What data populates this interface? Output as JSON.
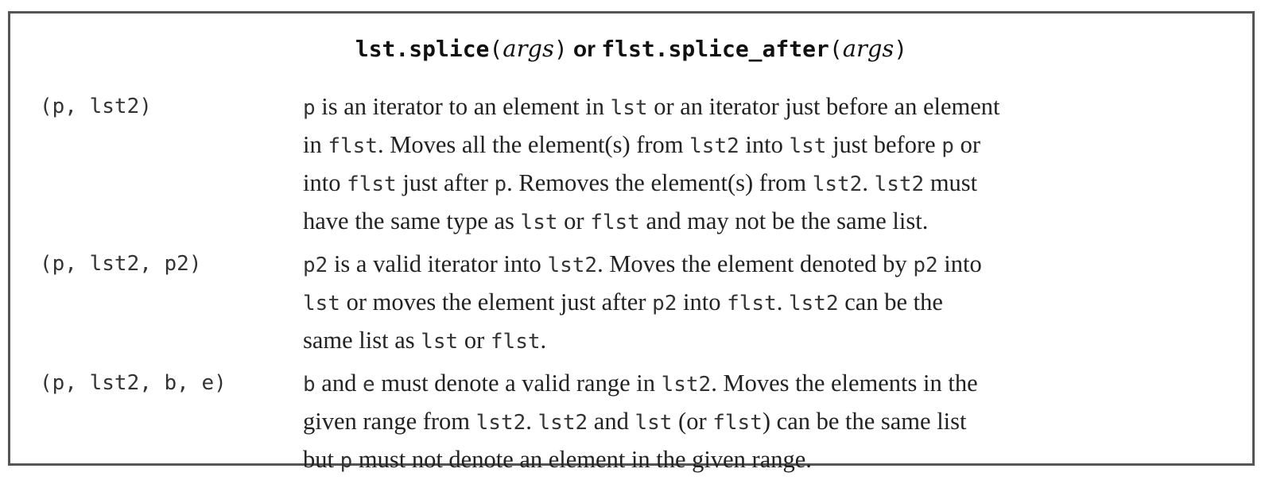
{
  "header": {
    "method1": "lst.splice",
    "method2": "flst.splice_after",
    "args": "args",
    "open": "(",
    "close": ")",
    "connector": "or"
  },
  "rows": [
    {
      "args": "(p, lst2)",
      "lines": [
        [
          [
            "c",
            "p"
          ],
          [
            "t",
            " is an iterator to an element in "
          ],
          [
            "c",
            "lst"
          ],
          [
            "t",
            " or an iterator just before an element"
          ]
        ],
        [
          [
            "t",
            "in "
          ],
          [
            "c",
            "flst"
          ],
          [
            "t",
            ". Moves all the element(s) from "
          ],
          [
            "c",
            "lst2"
          ],
          [
            "t",
            " into "
          ],
          [
            "c",
            "lst"
          ],
          [
            "t",
            " just before "
          ],
          [
            "c",
            "p"
          ],
          [
            "t",
            " or"
          ]
        ],
        [
          [
            "t",
            "into "
          ],
          [
            "c",
            "flst"
          ],
          [
            "t",
            " just after "
          ],
          [
            "c",
            "p"
          ],
          [
            "t",
            ". Removes the element(s) from "
          ],
          [
            "c",
            "lst2"
          ],
          [
            "t",
            ". "
          ],
          [
            "c",
            "lst2"
          ],
          [
            "t",
            " must"
          ]
        ],
        [
          [
            "t",
            "have the same type as "
          ],
          [
            "c",
            "lst"
          ],
          [
            "t",
            " or "
          ],
          [
            "c",
            "flst"
          ],
          [
            "t",
            " and may not be the same list."
          ]
        ]
      ]
    },
    {
      "args": "(p, lst2, p2)",
      "lines": [
        [
          [
            "c",
            "p2"
          ],
          [
            "t",
            " is a valid iterator into "
          ],
          [
            "c",
            "lst2"
          ],
          [
            "t",
            ". Moves the element denoted by "
          ],
          [
            "c",
            "p2"
          ],
          [
            "t",
            " into"
          ]
        ],
        [
          [
            "c",
            "lst"
          ],
          [
            "t",
            " or moves the element just after "
          ],
          [
            "c",
            "p2"
          ],
          [
            "t",
            " into "
          ],
          [
            "c",
            "flst"
          ],
          [
            "t",
            ". "
          ],
          [
            "c",
            "lst2"
          ],
          [
            "t",
            " can be the"
          ]
        ],
        [
          [
            "t",
            "same list as "
          ],
          [
            "c",
            "lst"
          ],
          [
            "t",
            " or "
          ],
          [
            "c",
            "flst"
          ],
          [
            "t",
            "."
          ]
        ]
      ]
    },
    {
      "args": "(p, lst2, b, e)",
      "lines": [
        [
          [
            "c",
            "b"
          ],
          [
            "t",
            " and "
          ],
          [
            "c",
            "e"
          ],
          [
            "t",
            " must denote a valid range in "
          ],
          [
            "c",
            "lst2"
          ],
          [
            "t",
            ". Moves the elements in the"
          ]
        ],
        [
          [
            "t",
            "given range from "
          ],
          [
            "c",
            "lst2"
          ],
          [
            "t",
            ". "
          ],
          [
            "c",
            "lst2"
          ],
          [
            "t",
            " and "
          ],
          [
            "c",
            "lst"
          ],
          [
            "t",
            " (or "
          ],
          [
            "c",
            "flst"
          ],
          [
            "t",
            ") can be the same list"
          ]
        ],
        [
          [
            "t",
            "but "
          ],
          [
            "c",
            "p"
          ],
          [
            "t",
            " must not denote an element in the given range."
          ]
        ]
      ]
    }
  ]
}
